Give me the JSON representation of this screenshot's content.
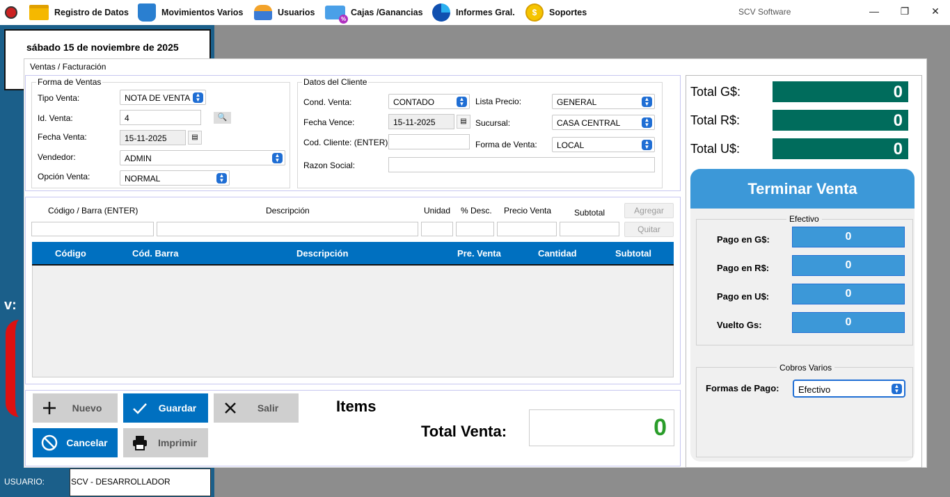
{
  "menu": {
    "items": [
      {
        "label": "Registro de Datos",
        "icon": "folder-icon"
      },
      {
        "label": "Movimientos Varios",
        "icon": "shopping-bag-icon"
      },
      {
        "label": "Usuarios",
        "icon": "users-icon"
      },
      {
        "label": "Cajas /Ganancias",
        "icon": "credit-card-icon"
      },
      {
        "label": "Informes Gral.",
        "icon": "pie-chart-icon"
      },
      {
        "label": "Soportes",
        "icon": "coin-icon"
      }
    ],
    "app_title": "SCV Software"
  },
  "sidebar": {
    "date": "sábado 15 de noviembre de 2025",
    "v_label": "v:",
    "user_label": "USUARIO:",
    "user_value": "SCV - DESARROLLADOR"
  },
  "form": {
    "title": "Ventas / Facturación",
    "forma_ventas": {
      "group_title": "Forma de Ventas",
      "tipo_venta_label": "Tipo Venta:",
      "tipo_venta_value": "NOTA DE VENTA",
      "id_venta_label": "Id. Venta:",
      "id_venta_value": "4",
      "fecha_venta_label": "Fecha Venta:",
      "fecha_venta_value": "15-11-2025",
      "vendedor_label": "Vendedor:",
      "vendedor_value": "ADMIN",
      "opcion_venta_label": "Opción Venta:",
      "opcion_venta_value": "NORMAL"
    },
    "cliente": {
      "group_title": "Datos del Cliente",
      "cond_venta_label": "Cond. Venta:",
      "cond_venta_value": "CONTADO",
      "fecha_vence_label": "Fecha Vence:",
      "fecha_vence_value": "15-11-2025",
      "cod_cliente_label": "Cod. Cliente: (ENTER)",
      "cod_cliente_value": "",
      "razon_social_label": "Razon Social:",
      "razon_social_value": "",
      "lista_precio_label": "Lista Precio:",
      "lista_precio_value": "GENERAL",
      "sucursal_label": "Sucursal:",
      "sucursal_value": "CASA CENTRAL",
      "forma_venta_label": "Forma de Venta:",
      "forma_venta_value": "LOCAL"
    },
    "item_entry": {
      "codigo_label": "Código / Barra   (ENTER)",
      "descripcion_label": "Descripción",
      "unidad_label": "Unidad",
      "desc_label": "% Desc.",
      "precio_label": "Precio Venta",
      "subtotal_label": "Subtotal",
      "agregar_label": "Agregar",
      "quitar_label": "Quitar"
    },
    "table": {
      "columns": [
        "Código",
        "Cód. Barra",
        "Descripción",
        "Pre. Venta",
        "Cantidad",
        "Subtotal"
      ]
    },
    "actions": {
      "nuevo": "Nuevo",
      "guardar": "Guardar",
      "salir": "Salir",
      "cancelar": "Cancelar",
      "imprimir": "Imprimir"
    },
    "items_label": "Items",
    "total_venta_label": "Total Venta:",
    "total_venta_value": "0"
  },
  "totals": {
    "total_gs_label": "Total G$:",
    "total_gs_value": "0",
    "total_rs_label": "Total R$:",
    "total_rs_value": "0",
    "total_us_label": "Total U$:",
    "total_us_value": "0"
  },
  "terminar": {
    "button_label": "Terminar Venta",
    "efectivo_title": "Efectivo",
    "pago_gs_label": "Pago en G$:",
    "pago_gs_value": "0",
    "pago_rs_label": "Pago en R$:",
    "pago_rs_value": "0",
    "pago_us_label": "Pago en U$:",
    "pago_us_value": "0",
    "vuelto_label": "Vuelto Gs:",
    "vuelto_value": "0",
    "cobros_title": "Cobros Varios",
    "formas_pago_label": "Formas de Pago:",
    "formas_pago_value": "Efectivo"
  },
  "colors": {
    "accent_blue": "#0070c0",
    "total_green": "#006c5c",
    "pay_blue": "#3c98d8",
    "total_venta_green": "#2a9d2a"
  }
}
